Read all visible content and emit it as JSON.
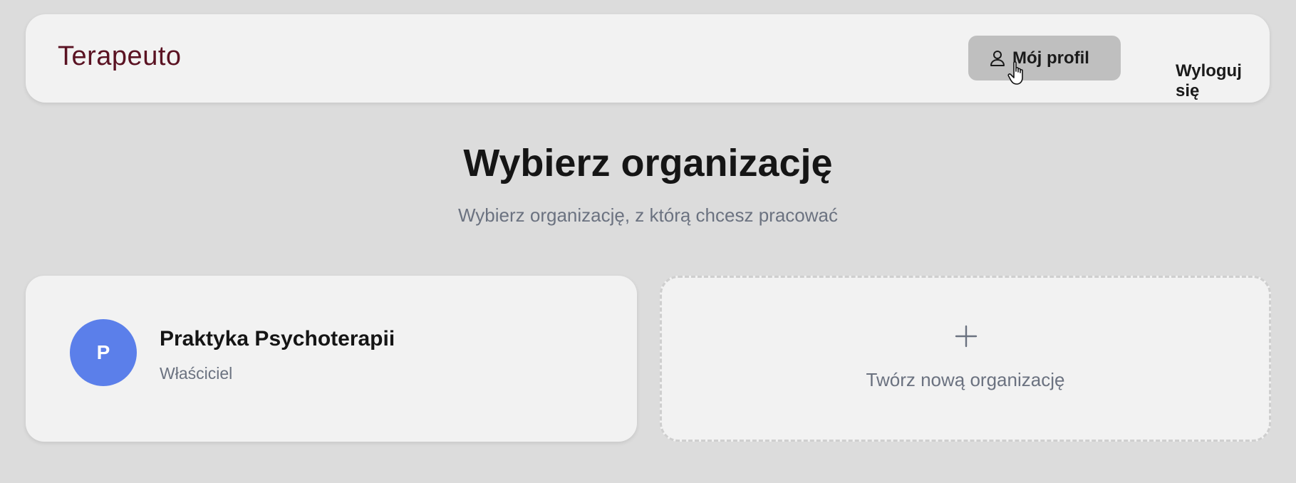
{
  "header": {
    "logo": "Terapeuto",
    "profile_label": "Mój profil",
    "profile_icon": "user-icon",
    "logout_label": "Wyloguj się"
  },
  "main": {
    "title": "Wybierz organizację",
    "subtitle": "Wybierz organizację, z którą chcesz pracować"
  },
  "organizations": [
    {
      "initial": "P",
      "name": "Praktyka Psychoterapii",
      "role": "Właściciel",
      "avatar_color": "#5b7fea"
    }
  ],
  "new_org": {
    "icon": "plus-icon",
    "label": "Twórz nową organizację"
  },
  "colors": {
    "background": "#dcdcdc",
    "card": "#f2f2f2",
    "brand": "#5a1222",
    "profile_button_hover": "#bfbfbf",
    "muted_text": "#6b7280"
  }
}
